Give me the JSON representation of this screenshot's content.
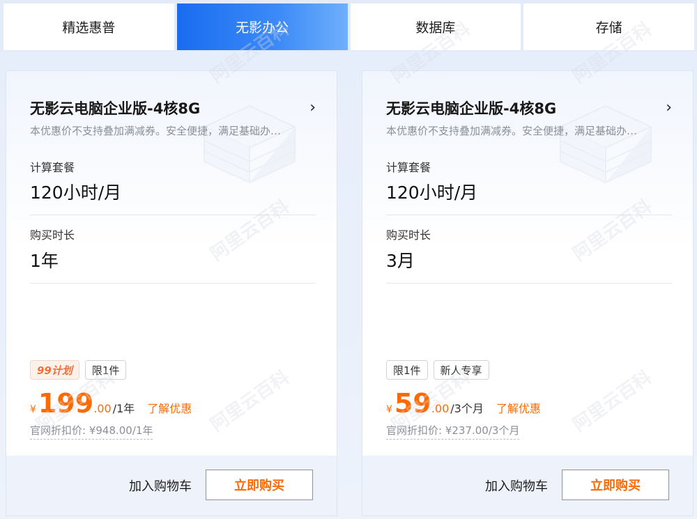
{
  "tabs": [
    {
      "label": "精选惠普",
      "active": false
    },
    {
      "label": "无影办公",
      "active": true
    },
    {
      "label": "数据库",
      "active": false
    },
    {
      "label": "存储",
      "active": false
    }
  ],
  "cards": [
    {
      "title": "无影云电脑企业版-4核8G",
      "description": "本优惠价不支持叠加满减券。安全便捷，满足基础办…",
      "compute_label": "计算套餐",
      "compute_value": "120小时/月",
      "duration_label": "购买时长",
      "duration_value": "1年",
      "tags": [
        "99计划",
        "限1件"
      ],
      "price": {
        "currency": "¥",
        "integer": "199",
        "decimal": ".00",
        "unit": "/1年"
      },
      "learn_more": "了解优惠",
      "original_price": "官网折扣价: ¥948.00/1年",
      "add_to_cart": "加入购物车",
      "buy_now": "立即购买"
    },
    {
      "title": "无影云电脑企业版-4核8G",
      "description": "本优惠价不支持叠加满减券。安全便捷，满足基础办…",
      "compute_label": "计算套餐",
      "compute_value": "120小时/月",
      "duration_label": "购买时长",
      "duration_value": "3月",
      "tags": [
        "限1件",
        "新人专享"
      ],
      "price": {
        "currency": "¥",
        "integer": "59",
        "decimal": ".00",
        "unit": "/3个月"
      },
      "learn_more": "了解优惠",
      "original_price": "官网折扣价: ¥237.00/3个月",
      "add_to_cart": "加入购物车",
      "buy_now": "立即购买"
    }
  ],
  "watermark": "阿里云百科",
  "icons": {
    "chevron": "chevron-right-icon"
  },
  "colors": {
    "accent": "#1a6cf0",
    "price": "#ff6a00",
    "promo_tag": "#f0703c"
  }
}
